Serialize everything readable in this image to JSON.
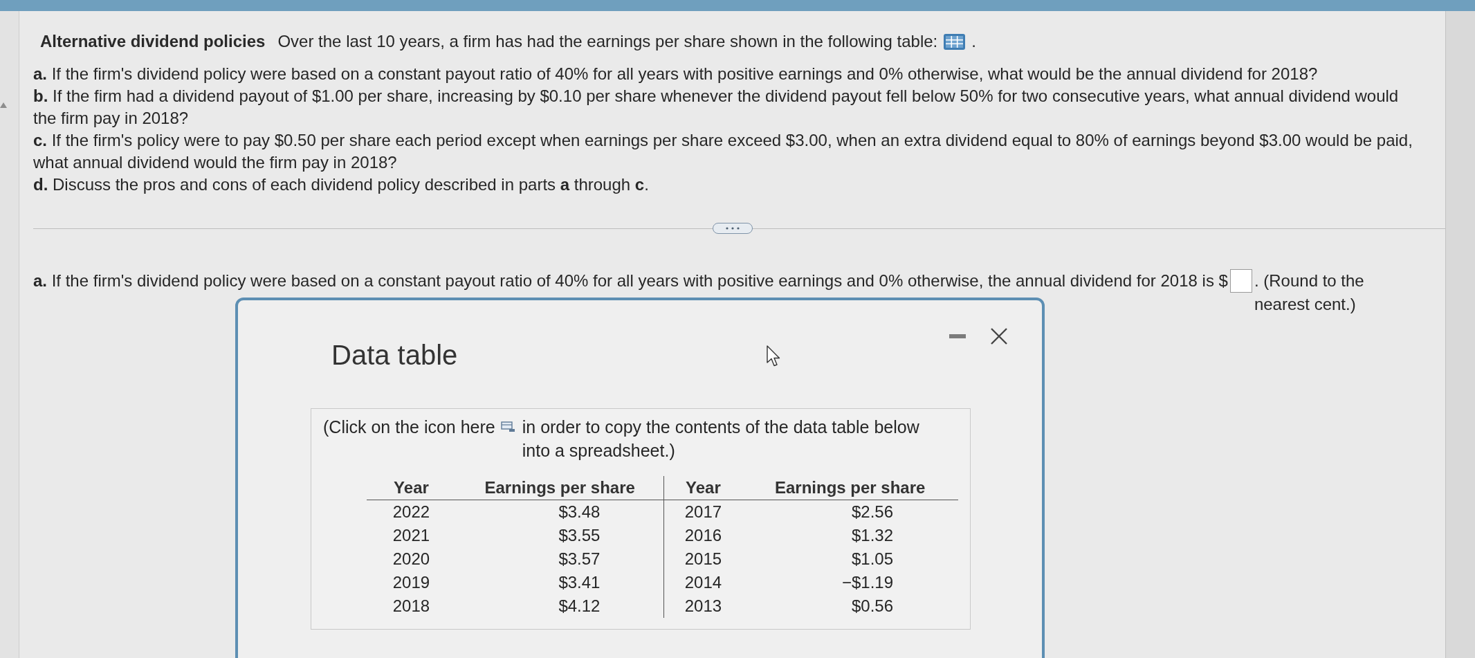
{
  "problem": {
    "title": "Alternative dividend policies",
    "intro": "Over the last 10 years, a firm has had the earnings per share shown in the following table:",
    "after_icon": "."
  },
  "questions": [
    {
      "label": "a.",
      "text": "If the firm's dividend policy were based on a constant payout ratio of 40% for all years with positive earnings and 0% otherwise, what would be the annual dividend for 2018?"
    },
    {
      "label": "b.",
      "text": "If the firm had a dividend payout of $1.00 per share, increasing by $0.10 per share whenever the dividend payout fell below 50% for two consecutive years, what annual dividend would the firm pay in 2018?"
    },
    {
      "label": "c.",
      "text": "If the firm's policy were to pay $0.50 per share each period except when earnings per share exceed $3.00, when an extra dividend equal to 80% of earnings beyond $3.00 would be paid, what annual dividend would the firm pay in 2018?"
    },
    {
      "label": "d.",
      "text": "Discuss the pros and cons of each dividend policy described in parts **a** through **c**."
    }
  ],
  "answer": {
    "label": "a.",
    "prompt": "If the firm's dividend policy were based on a constant payout ratio of 40% for all years with positive earnings and 0% otherwise, the annual dividend for 2018 is $",
    "after": ". (Round to the nearest cent.)"
  },
  "dialog": {
    "title": "Data table",
    "instructions_before": "(Click on the icon here",
    "instructions_after": "in order to copy the contents of the data table below into a spreadsheet.)",
    "table": {
      "columns": [
        "Year",
        "Earnings per share",
        "Year",
        "Earnings per share"
      ],
      "rows": [
        [
          "2022",
          "$3.48",
          "2017",
          "$2.56"
        ],
        [
          "2021",
          "$3.55",
          "2016",
          "$1.32"
        ],
        [
          "2020",
          "$3.57",
          "2015",
          "$1.05"
        ],
        [
          "2019",
          "$3.41",
          "2014",
          "−$1.19"
        ],
        [
          "2018",
          "$4.12",
          "2013",
          "$0.56"
        ]
      ]
    }
  }
}
